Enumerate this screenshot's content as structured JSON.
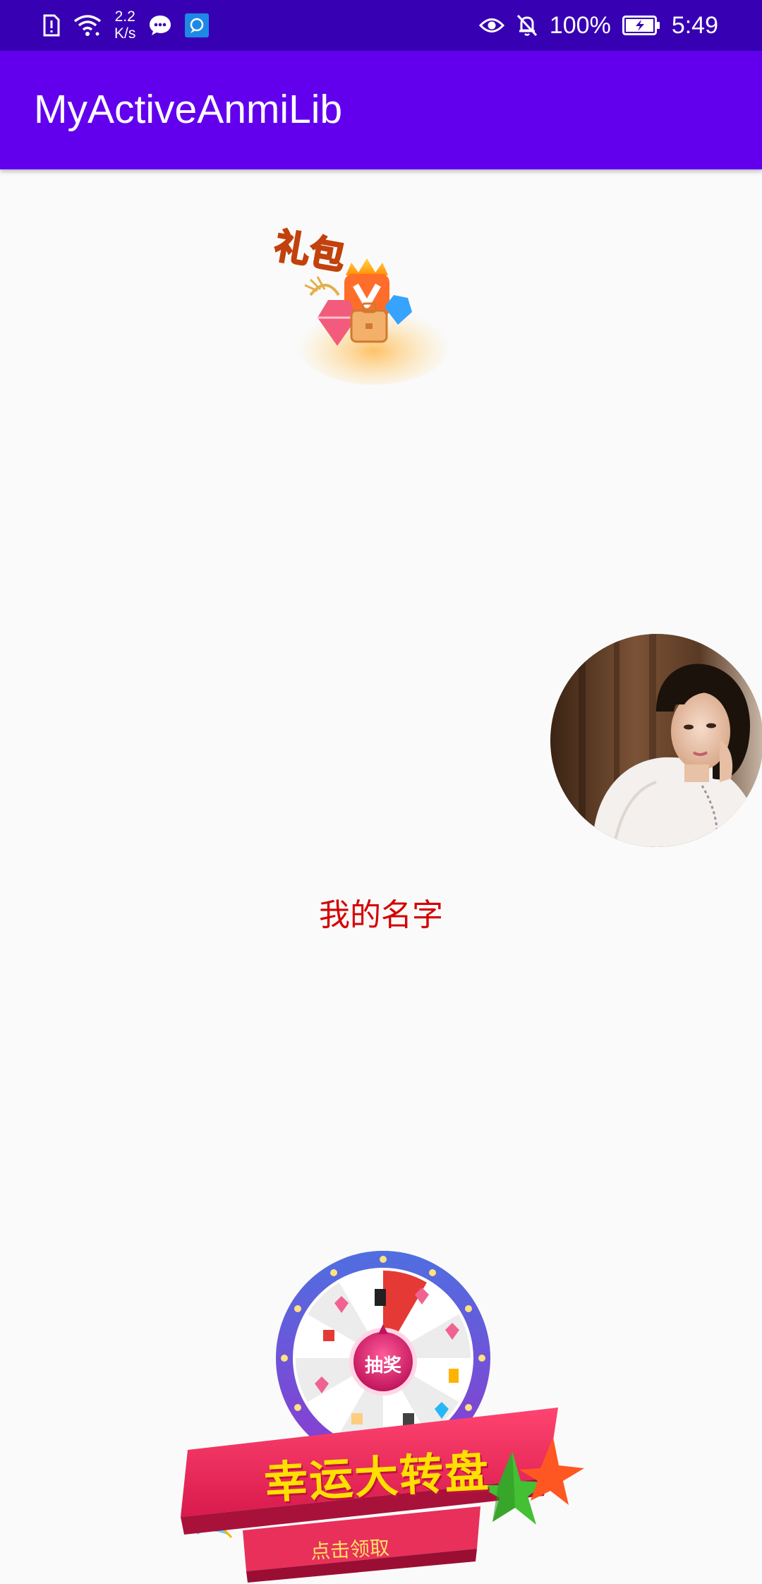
{
  "status_bar": {
    "net_speed_value": "2.2",
    "net_speed_unit": "K/s",
    "battery_percent": "100%",
    "time": "5:49",
    "icons": [
      "sim-alert-icon",
      "wifi-icon",
      "chat-bubble-icon",
      "app-notification-icon",
      "eye-icon",
      "bell-off-icon",
      "battery-charging-icon"
    ]
  },
  "app_bar": {
    "title": "MyActiveAnmiLib"
  },
  "main": {
    "vip_bag_text_fragment": "礼包",
    "name_text": "我的名字"
  },
  "lucky_wheel": {
    "center_label": "抽奖",
    "title": "幸运大转盘",
    "subtitle": "点击领取",
    "colors": {
      "ring": "#7b3fd6",
      "banner": "#e8305a",
      "title": "#ffe000"
    }
  },
  "colors": {
    "status_bar": "#3700b3",
    "app_bar": "#6200ee",
    "name_text": "#d50000",
    "background": "#fafafa"
  }
}
